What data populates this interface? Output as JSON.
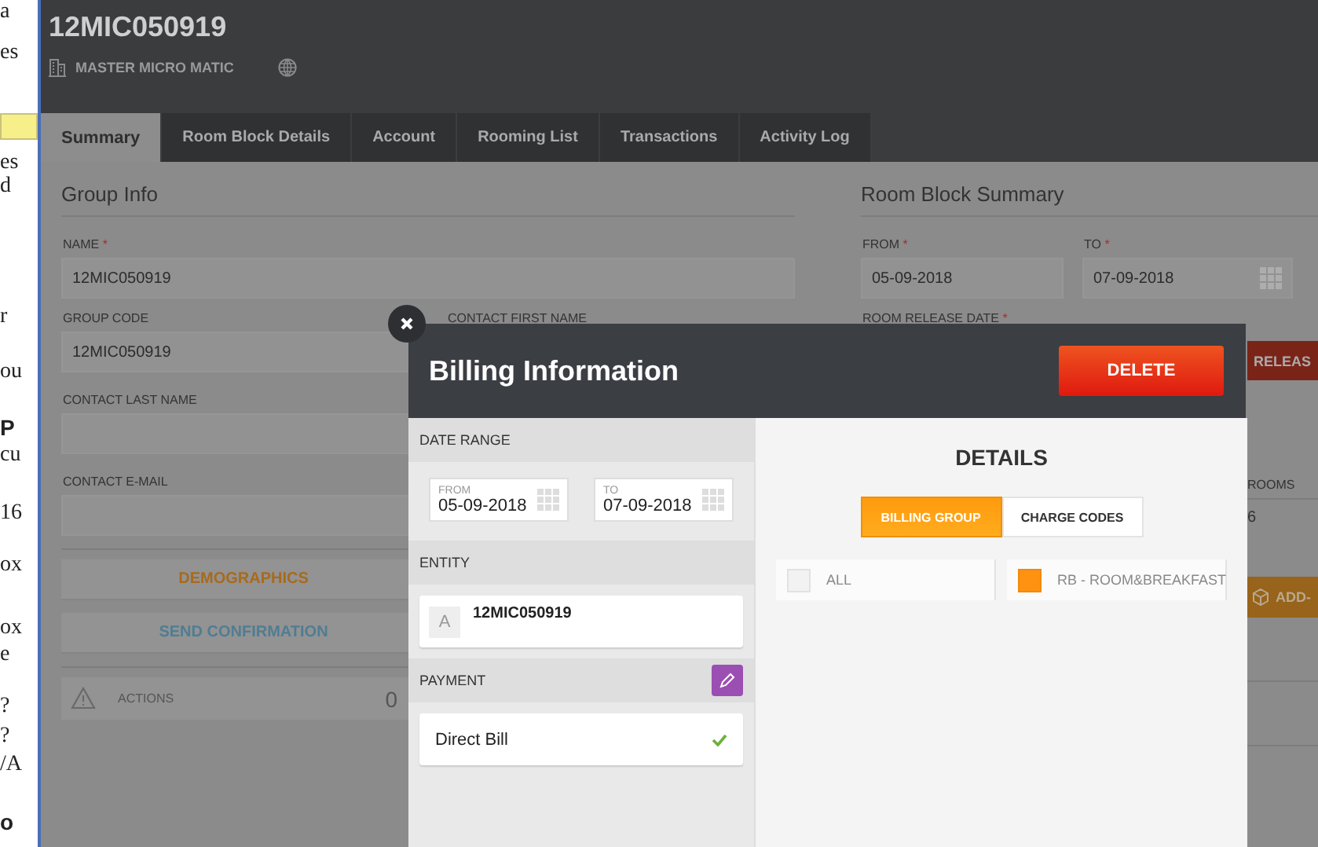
{
  "background_window": {
    "lines": [
      {
        "text": "a",
        "kind": "plain"
      },
      {
        "text": "es",
        "kind": "plain"
      },
      {
        "kind": "highlight"
      },
      {
        "text": "es",
        "kind": "plain"
      },
      {
        "text": "d",
        "kind": "plain"
      },
      {
        "text": "r",
        "kind": "plain"
      },
      {
        "text": "ou",
        "kind": "plain"
      },
      {
        "text": "P",
        "kind": "bold"
      },
      {
        "text": "cu",
        "kind": "plain"
      },
      {
        "text": "16",
        "kind": "plain"
      },
      {
        "text": "ox",
        "kind": "plain"
      },
      {
        "text": "ox",
        "kind": "plain"
      },
      {
        "text": "e",
        "kind": "plain"
      },
      {
        "text": "?",
        "kind": "plain"
      },
      {
        "text": "?",
        "kind": "plain"
      },
      {
        "text": "/A",
        "kind": "plain"
      },
      {
        "text": "o",
        "kind": "bold"
      }
    ]
  },
  "header": {
    "title": "12MIC050919",
    "subtitle": "MASTER MICRO MATIC"
  },
  "tabs": [
    {
      "label": "Summary",
      "selected": true
    },
    {
      "label": "Room Block Details",
      "selected": false
    },
    {
      "label": "Account",
      "selected": false
    },
    {
      "label": "Rooming List",
      "selected": false
    },
    {
      "label": "Transactions",
      "selected": false
    },
    {
      "label": "Activity Log",
      "selected": false
    }
  ],
  "group_info": {
    "title": "Group Info",
    "fields": [
      {
        "label": "NAME",
        "marker": "*",
        "value": "12MIC050919"
      },
      {
        "label": "GROUP CODE",
        "value": "12MIC050919"
      },
      {
        "label": "CONTACT FIRST NAME"
      },
      {
        "label": "CONTACT LAST NAME"
      },
      {
        "label": "CONTACT E-MAIL"
      }
    ],
    "buttons": [
      {
        "label": "DEMOGRAPHICS",
        "color": "#a86a1c"
      },
      {
        "label": "SEND CONFIRMATION",
        "color": "#4f7d93"
      }
    ],
    "actions": {
      "label": "ACTIONS",
      "count": "0"
    }
  },
  "room_block_summary": {
    "title": "Room Block Summary",
    "fields": [
      {
        "label": "FROM",
        "marker": "*",
        "value": "05-09-2018"
      },
      {
        "label": "TO",
        "marker": "*",
        "value": "07-09-2018"
      }
    ],
    "release_label": "ROOM RELEASE DATE",
    "release_marker": "*",
    "release_button": "RELEAS",
    "rooms_label": "ROOMS",
    "rooms_value": "6",
    "add_button": "ADD-"
  },
  "dialog": {
    "title": "Billing Information",
    "delete_button": "DELETE",
    "date_range": {
      "title": "DATE RANGE",
      "from_label": "FROM",
      "from": "05-09-2018",
      "to_label": "TO",
      "to": "07-09-2018"
    },
    "entity": {
      "title": "ENTITY",
      "initial": "A",
      "name": "12MIC050919"
    },
    "payment": {
      "title": "PAYMENT",
      "method": "Direct Bill",
      "confirmed": true
    },
    "details": {
      "title": "DETAILS",
      "toggle": [
        {
          "label": "BILLING GROUP",
          "selected": true
        },
        {
          "label": "CHARGE CODES",
          "selected": false
        }
      ],
      "options": [
        {
          "label": "ALL",
          "checked": false
        },
        {
          "label": "RB - ROOM&BREAKFAST",
          "checked": true
        }
      ]
    }
  }
}
